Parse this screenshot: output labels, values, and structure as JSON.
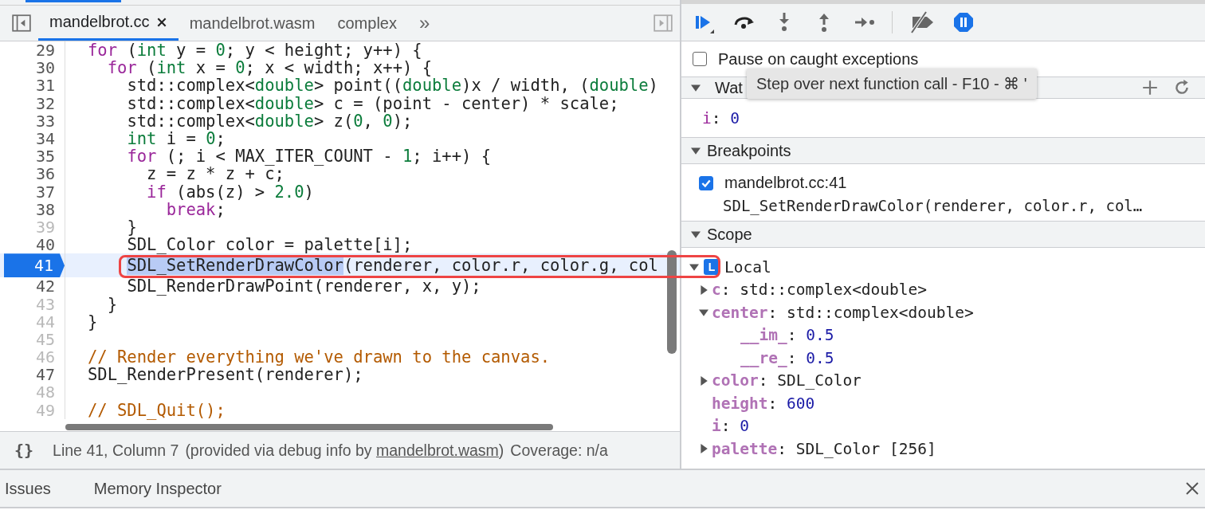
{
  "editor": {
    "tabs": [
      {
        "label": "mandelbrot.cc",
        "selected": true,
        "closable": true
      },
      {
        "label": "mandelbrot.wasm",
        "selected": false,
        "closable": false
      },
      {
        "label": "complex",
        "selected": false,
        "closable": false
      }
    ],
    "overflow": "»",
    "lines": [
      {
        "number": "29",
        "mapped": true,
        "current": false,
        "tokens": [
          {
            "kind": "keyword",
            "text": "for"
          },
          {
            "kind": "plain",
            "text": " ("
          },
          {
            "kind": "type",
            "text": "int"
          },
          {
            "kind": "plain",
            "text": " y = "
          },
          {
            "kind": "number",
            "text": "0"
          },
          {
            "kind": "plain",
            "text": "; y < height; y++) {"
          }
        ]
      },
      {
        "number": "30",
        "mapped": true,
        "current": false,
        "tokens": [
          {
            "kind": "keyword",
            "text": "  for"
          },
          {
            "kind": "plain",
            "text": " ("
          },
          {
            "kind": "type",
            "text": "int"
          },
          {
            "kind": "plain",
            "text": " x = "
          },
          {
            "kind": "number",
            "text": "0"
          },
          {
            "kind": "plain",
            "text": "; x < width; x++) {"
          }
        ]
      },
      {
        "number": "31",
        "mapped": true,
        "current": false,
        "tokens": [
          {
            "kind": "plain",
            "text": "    std::complex<"
          },
          {
            "kind": "type",
            "text": "double"
          },
          {
            "kind": "plain",
            "text": "> point(("
          },
          {
            "kind": "type",
            "text": "double"
          },
          {
            "kind": "plain",
            "text": ")x / width, ("
          },
          {
            "kind": "type",
            "text": "double"
          },
          {
            "kind": "plain",
            "text": ")"
          }
        ]
      },
      {
        "number": "32",
        "mapped": true,
        "current": false,
        "tokens": [
          {
            "kind": "plain",
            "text": "    std::complex<"
          },
          {
            "kind": "type",
            "text": "double"
          },
          {
            "kind": "plain",
            "text": "> c = (point - center) * scale;"
          }
        ]
      },
      {
        "number": "33",
        "mapped": true,
        "current": false,
        "tokens": [
          {
            "kind": "plain",
            "text": "    std::complex<"
          },
          {
            "kind": "type",
            "text": "double"
          },
          {
            "kind": "plain",
            "text": "> z("
          },
          {
            "kind": "number",
            "text": "0"
          },
          {
            "kind": "plain",
            "text": ", "
          },
          {
            "kind": "number",
            "text": "0"
          },
          {
            "kind": "plain",
            "text": ");"
          }
        ]
      },
      {
        "number": "34",
        "mapped": true,
        "current": false,
        "tokens": [
          {
            "kind": "type",
            "text": "    int"
          },
          {
            "kind": "plain",
            "text": " i = "
          },
          {
            "kind": "number",
            "text": "0"
          },
          {
            "kind": "plain",
            "text": ";"
          }
        ]
      },
      {
        "number": "35",
        "mapped": true,
        "current": false,
        "tokens": [
          {
            "kind": "keyword",
            "text": "    for"
          },
          {
            "kind": "plain",
            "text": " (; i < MAX_ITER_COUNT - "
          },
          {
            "kind": "number",
            "text": "1"
          },
          {
            "kind": "plain",
            "text": "; i++) {"
          }
        ]
      },
      {
        "number": "36",
        "mapped": true,
        "current": false,
        "tokens": [
          {
            "kind": "plain",
            "text": "      z = z * z + c;"
          }
        ]
      },
      {
        "number": "37",
        "mapped": true,
        "current": false,
        "tokens": [
          {
            "kind": "keyword",
            "text": "      if"
          },
          {
            "kind": "plain",
            "text": " (abs(z) > "
          },
          {
            "kind": "number",
            "text": "2.0"
          },
          {
            "kind": "plain",
            "text": ")"
          }
        ]
      },
      {
        "number": "38",
        "mapped": true,
        "current": false,
        "tokens": [
          {
            "kind": "keyword",
            "text": "        break"
          },
          {
            "kind": "plain",
            "text": ";"
          }
        ]
      },
      {
        "number": "39",
        "mapped": false,
        "current": false,
        "tokens": [
          {
            "kind": "plain",
            "text": "    }"
          }
        ]
      },
      {
        "number": "40",
        "mapped": true,
        "current": false,
        "tokens": [
          {
            "kind": "plain",
            "text": "    SDL_Color color = palette[i];"
          }
        ]
      },
      {
        "number": "41",
        "mapped": true,
        "current": true,
        "tokens": [
          {
            "kind": "selected",
            "text": "    SDL_SetRenderDrawColor"
          },
          {
            "kind": "plain",
            "text": "(renderer, color.r, color.g, col"
          }
        ]
      },
      {
        "number": "42",
        "mapped": true,
        "current": false,
        "tokens": [
          {
            "kind": "plain",
            "text": "    SDL_RenderDrawPoint(renderer, x, y);"
          }
        ]
      },
      {
        "number": "43",
        "mapped": false,
        "current": false,
        "tokens": [
          {
            "kind": "plain",
            "text": "  }"
          }
        ]
      },
      {
        "number": "44",
        "mapped": false,
        "current": false,
        "tokens": [
          {
            "kind": "plain",
            "text": "}"
          }
        ]
      },
      {
        "number": "45",
        "mapped": false,
        "current": false
      },
      {
        "number": "46",
        "mapped": false,
        "current": false,
        "tokens": [
          {
            "kind": "comment",
            "text": "// Render everything we've drawn to the canvas."
          }
        ]
      },
      {
        "number": "47",
        "mapped": true,
        "current": false,
        "tokens": [
          {
            "kind": "plain",
            "text": "SDL_RenderPresent(renderer);"
          }
        ]
      },
      {
        "number": "48",
        "mapped": false,
        "current": false
      },
      {
        "number": "49",
        "mapped": false,
        "current": false,
        "tokens": [
          {
            "kind": "comment",
            "text": "// SDL_Quit();"
          }
        ]
      }
    ],
    "status": {
      "icon": "{}",
      "position": "Line 41, Column 7",
      "source_prefix": "(provided via debug info by ",
      "source_link": "mandelbrot.wasm",
      "source_suffix": ")",
      "coverage": "Coverage: n/a"
    }
  },
  "debugger": {
    "tooltip": "Step over next function call - F10 - ⌘ '",
    "pause_on_caught": {
      "label": "Pause on caught exceptions",
      "checked": false
    },
    "watch": {
      "title": "Wat",
      "expanded": true,
      "items": [
        {
          "name": "i",
          "sep": ":",
          "value": "0"
        }
      ]
    },
    "breakpoints": {
      "title": "Breakpoints",
      "expanded": true,
      "items": [
        {
          "location": "mandelbrot.cc:41",
          "code": "SDL_SetRenderDrawColor(renderer, color.r, col…",
          "checked": true
        }
      ]
    },
    "scope": {
      "title": "Scope",
      "expanded": true,
      "local": {
        "badge": "L",
        "label": "Local",
        "expanded": true,
        "children": [
          {
            "name": "c",
            "sep": ":",
            "value": "std::complex<double>",
            "kind": "type",
            "expanded": false
          },
          {
            "name": "center",
            "sep": ":",
            "value": "std::complex<double>",
            "kind": "type",
            "expanded": true,
            "children": [
              {
                "name": "__im_",
                "sep": ":",
                "value": "0.5",
                "kind": "number"
              },
              {
                "name": "__re_",
                "sep": ":",
                "value": "0.5",
                "kind": "number"
              }
            ]
          },
          {
            "name": "color",
            "sep": ":",
            "value": "SDL_Color",
            "kind": "type",
            "expanded": false
          },
          {
            "name": "height",
            "sep": ":",
            "value": "600",
            "kind": "number"
          },
          {
            "name": "i",
            "sep": ":",
            "value": "0",
            "kind": "number"
          },
          {
            "name": "palette",
            "sep": ":",
            "value": "SDL_Color [256]",
            "kind": "type",
            "expanded": false
          }
        ]
      }
    }
  },
  "drawer": {
    "tabs": [
      {
        "label": "Issues"
      },
      {
        "label": "Memory Inspector"
      }
    ]
  }
}
